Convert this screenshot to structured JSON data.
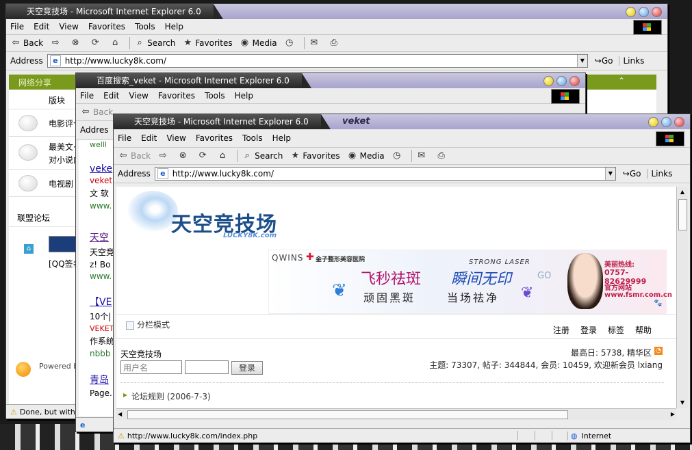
{
  "browser": {
    "menu": [
      "File",
      "Edit",
      "View",
      "Favorites",
      "Tools",
      "Help"
    ],
    "toolbar": {
      "back": "Back",
      "search": "Search",
      "favorites": "Favorites",
      "media": "Media"
    },
    "address_label": "Address",
    "go_label": "Go",
    "links_label": "Links"
  },
  "win1": {
    "title": "天空竞技场 - Microsoft Internet Explorer 6.0",
    "url": "http://www.lucky8k.com/",
    "status": "Done, but with",
    "top_band": "网络分享",
    "section_label": "版块",
    "rows": [
      "电影评个",
      "最美文·",
      "对小说内",
      "电视剧"
    ],
    "alliance": "联盟论坛",
    "alliance_item": "[QQ签名",
    "powered": "Powered b",
    "accent": "#7a9a1e"
  },
  "win2": {
    "title": "百度搜索_veket - Microsoft Internet Explorer 6.0",
    "address_label": "Addres",
    "results": [
      {
        "title": "veke",
        "lines": [
          "veket",
          "文 软",
          "www."
        ]
      },
      {
        "title": "天空",
        "lines": [
          "天空竞",
          "z! Bo",
          "www."
        ]
      },
      {
        "title": "【VE",
        "lines": [
          "10个|",
          "VEKET",
          "作系统",
          "nbbb"
        ]
      },
      {
        "title": "青岛",
        "lines": [
          "Page."
        ]
      }
    ],
    "fragment_top": "welll"
  },
  "win3": {
    "title": "天空竞技场 - Microsoft Internet Explorer 6.0",
    "title_extra": "veket",
    "url": "http://www.lucky8k.com/",
    "status_url": "http://www.lucky8k.com/index.php",
    "zone": "Internet",
    "logo_main": "天空竞技场",
    "logo_sub": "LUCKY8K.com",
    "banner": {
      "brand": "QWINS",
      "clinic": "金子整形美容医院",
      "laser": "STRONG LASER",
      "slogan1": "飞秒祛斑",
      "slogan2": "瞬间无印",
      "slogan3": "顽固黑斑",
      "slogan4": "当场祛净",
      "go": "GO",
      "hotline_label": "美丽热线:",
      "hotline": "0757-82629999",
      "site_label": "官方网站",
      "site": "www.fsmr.com.cn"
    },
    "split_mode": "分栏模式",
    "nav": [
      "注册",
      "登录",
      "标签",
      "帮助"
    ],
    "site_name": "天空竞技场",
    "username_placeholder": "用户名",
    "login_button": "登录",
    "stats_line1": "最高日: 5738,    精华区",
    "stats_line2": "主题: 73307, 帖子: 344844, 会员: 10459, 欢迎新会员 lxiang",
    "rule_link": "论坛规则 (2006-7-3)"
  }
}
